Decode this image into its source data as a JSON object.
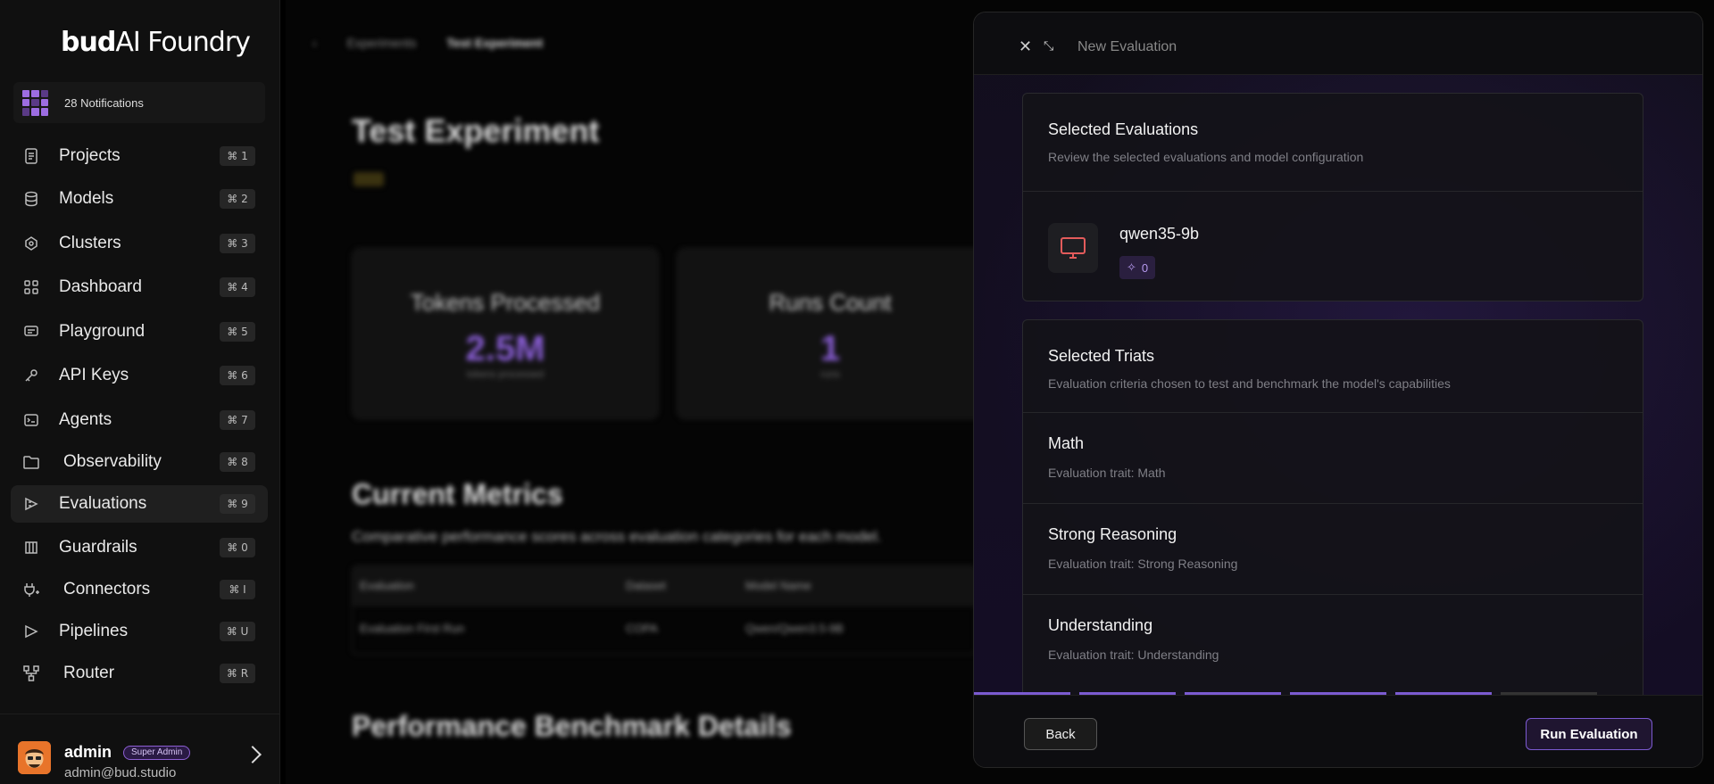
{
  "brand": {
    "logo_bold": "bud",
    "logo_rest": "AI Foundry"
  },
  "notifications": {
    "label": "28 Notifications"
  },
  "nav": [
    {
      "label": "Projects",
      "shortcut": "⌘ 1",
      "icon": "document-icon"
    },
    {
      "label": "Models",
      "shortcut": "⌘ 2",
      "icon": "database-icon"
    },
    {
      "label": "Clusters",
      "shortcut": "⌘ 3",
      "icon": "cluster-icon"
    },
    {
      "label": "Dashboard",
      "shortcut": "⌘ 4",
      "icon": "grid-icon"
    },
    {
      "label": "Playground",
      "shortcut": "⌘ 5",
      "icon": "chat-icon"
    },
    {
      "label": "API Keys",
      "shortcut": "⌘ 6",
      "icon": "key-icon"
    },
    {
      "label": "Agents",
      "shortcut": "⌘ 7",
      "icon": "terminal-icon"
    },
    {
      "label": "Observability",
      "shortcut": "⌘ 8",
      "icon": "folder-icon"
    },
    {
      "label": "Evaluations",
      "shortcut": "⌘ 9",
      "icon": "evaluation-icon",
      "active": true
    },
    {
      "label": "Guardrails",
      "shortcut": "⌘ 0",
      "icon": "shield-icon"
    },
    {
      "label": "Connectors",
      "shortcut": "⌘ I",
      "icon": "plug-icon"
    },
    {
      "label": "Pipelines",
      "shortcut": "⌘ U",
      "icon": "pipeline-icon"
    },
    {
      "label": "Router",
      "shortcut": "⌘ R",
      "icon": "router-icon"
    }
  ],
  "user": {
    "name": "admin",
    "role": "Super Admin",
    "email": "admin@bud.studio"
  },
  "background": {
    "breadcrumb": [
      "Experiments",
      "Test Experiment"
    ],
    "title": "Test Experiment",
    "cards": [
      {
        "title": "Tokens Processed",
        "value": "2.5M",
        "sub": "tokens processed"
      },
      {
        "title": "Runs Count",
        "value": "1",
        "sub": "runs"
      }
    ],
    "metrics_title": "Current Metrics",
    "metrics_desc": "Comparative performance scores across evaluation categories for each model.",
    "table_headers": [
      "Evaluation",
      "Dataset",
      "Model Name"
    ],
    "table_row": [
      "Evaluation First Run",
      "COPA",
      "Qwen/Qwen3.5-9B"
    ],
    "benchmark_title": "Performance Benchmark Details"
  },
  "drawer": {
    "title": "New Evaluation",
    "selected": {
      "heading": "Selected Evaluations",
      "description": "Review the selected evaluations and model configuration",
      "model_name": "qwen35-9b",
      "model_tag_count": "0"
    },
    "traits": {
      "heading": "Selected Triats",
      "description": "Evaluation criteria chosen to test and benchmark the model's capabilities",
      "items": [
        {
          "name": "Math",
          "desc": "Evaluation trait: Math"
        },
        {
          "name": "Strong Reasoning",
          "desc": "Evaluation trait: Strong Reasoning"
        },
        {
          "name": "Understanding",
          "desc": "Evaluation trait: Understanding"
        }
      ]
    },
    "progress_steps_done": 5,
    "progress_steps_total": 6,
    "back_label": "Back",
    "run_label": "Run Evaluation"
  },
  "colors": {
    "accent": "#7b5bd1",
    "badge": "#8d5fd3",
    "model_icon": "#e35b5b"
  }
}
